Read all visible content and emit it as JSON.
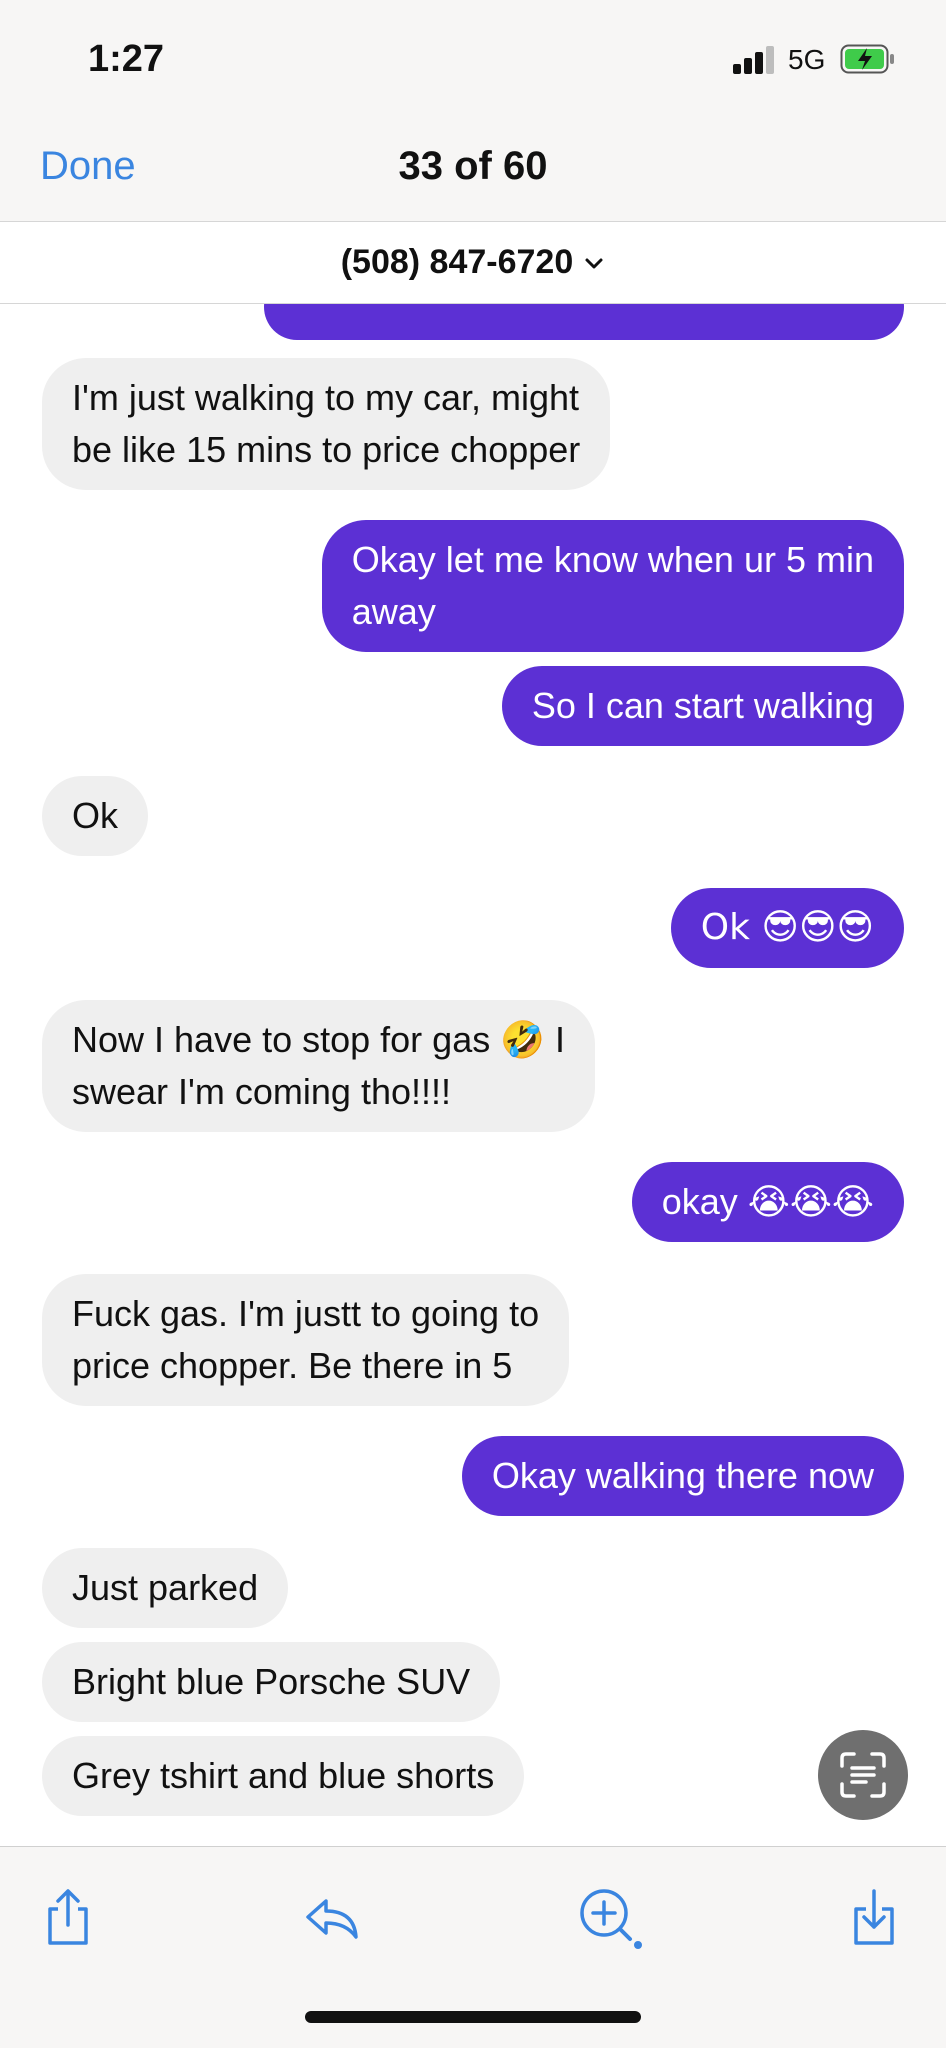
{
  "status": {
    "time": "1:27",
    "network": "5G"
  },
  "header": {
    "done_label": "Done",
    "counter": "33 of 60"
  },
  "contact": {
    "phone": "(508) 847-6720"
  },
  "messages": [
    {
      "side": "received",
      "lines": [
        "I'm just walking to my car, might",
        "be like 15 mins to price chopper"
      ]
    },
    {
      "side": "sent",
      "lines": [
        "Okay let me know when ur 5 min",
        "away"
      ]
    },
    {
      "side": "sent",
      "lines": [
        "So I can start walking"
      ]
    },
    {
      "side": "received",
      "lines": [
        "Ok"
      ]
    },
    {
      "side": "sent",
      "lines": [
        "Ok 😎😎😎"
      ]
    },
    {
      "side": "received",
      "lines": [
        "Now I have to stop for gas 🤣 I",
        "swear I'm coming tho!!!!"
      ]
    },
    {
      "side": "sent",
      "lines": [
        "okay 😭😭😭"
      ]
    },
    {
      "side": "received",
      "lines": [
        "Fuck gas. I'm justt to going to",
        "price chopper. Be there in 5"
      ]
    },
    {
      "side": "sent",
      "lines": [
        "Okay walking there now"
      ]
    },
    {
      "side": "received",
      "lines": [
        "Just parked"
      ]
    },
    {
      "side": "received",
      "lines": [
        "Bright blue Porsche SUV"
      ]
    },
    {
      "side": "received",
      "lines": [
        "Grey tshirt and blue shorts"
      ]
    }
  ],
  "toolbar": {
    "share_icon": "share-icon",
    "reply_icon": "reply-icon",
    "zoom_icon": "zoom-in-icon",
    "save_icon": "save-icon"
  },
  "colors": {
    "sent_bubble": "#5c30d4",
    "received_bubble": "#efefef",
    "accent": "#3a85e0"
  }
}
